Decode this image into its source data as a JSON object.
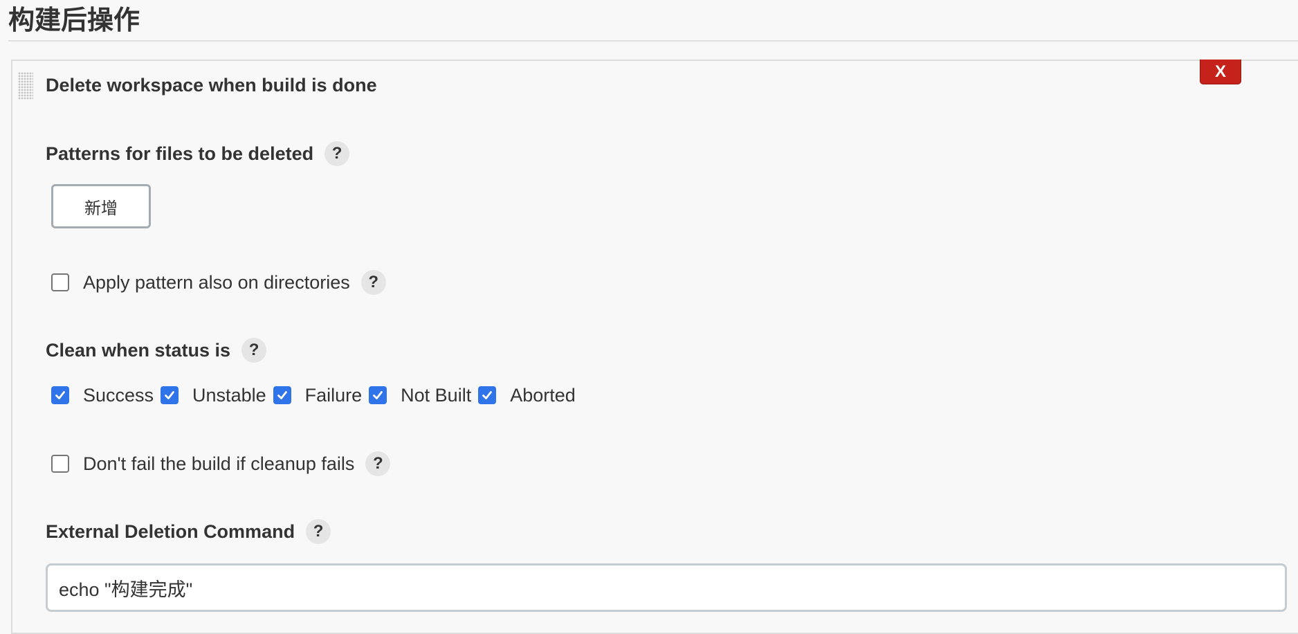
{
  "section": {
    "title": "构建后操作"
  },
  "step": {
    "title": "Delete workspace when build is done",
    "delete_label": "X"
  },
  "patterns": {
    "label": "Patterns for files to be deleted",
    "add_label": "新增"
  },
  "apply_dirs": {
    "label": "Apply pattern also on directories",
    "checked": false
  },
  "clean_status": {
    "label": "Clean when status is",
    "options": [
      {
        "label": "Success",
        "checked": true
      },
      {
        "label": "Unstable",
        "checked": true
      },
      {
        "label": "Failure",
        "checked": true
      },
      {
        "label": "Not Built",
        "checked": true
      },
      {
        "label": "Aborted",
        "checked": true
      }
    ]
  },
  "dont_fail": {
    "label": "Don't fail the build if cleanup fails",
    "checked": false
  },
  "external_cmd": {
    "label": "External Deletion Command",
    "value": "echo \"构建完成\""
  },
  "help_glyph": "?",
  "icons": {
    "help": "question-circle-icon",
    "drag": "drag-handle-icon",
    "check": "checkmark-icon"
  },
  "colors": {
    "delete_button": "#c4221b",
    "checkbox_checked": "#2f74e8",
    "help_bg": "#e5e5e5"
  }
}
